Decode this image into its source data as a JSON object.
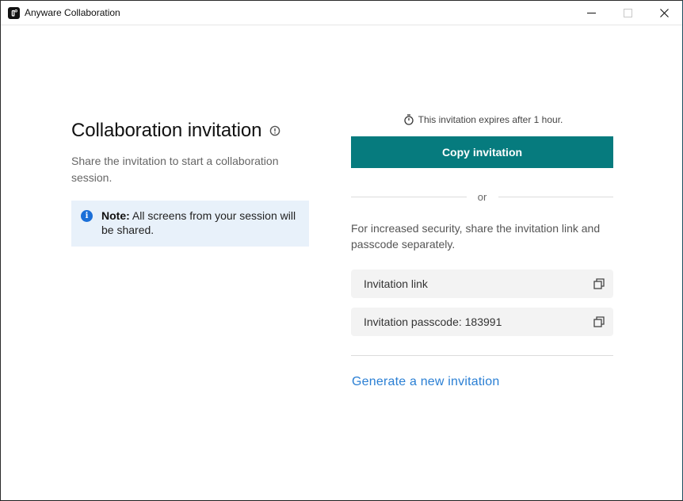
{
  "window": {
    "title": "Anyware Collaboration",
    "app_icon": "anyware-logo-icon",
    "controls": {
      "minimize": "minimize-icon",
      "maximize": "maximize-icon",
      "close": "close-icon"
    }
  },
  "left_panel": {
    "heading": "Collaboration invitation",
    "heading_icon": "info-outline-icon",
    "subtitle": "Share the invitation to start a collaboration session.",
    "note": {
      "icon": "info-filled-icon",
      "label": "Note:",
      "text": " All screens from your session will be shared."
    }
  },
  "right_panel": {
    "expiry_icon": "timer-icon",
    "expiry_text": "This invitation expires after 1 hour.",
    "copy_button": "Copy invitation",
    "or_text": "or",
    "security_text": "For increased security, share the invitation link and passcode separately.",
    "fields": [
      {
        "label": "Invitation link",
        "icon": "copy-icon"
      },
      {
        "label": "Invitation passcode: 183991",
        "icon": "copy-icon"
      }
    ],
    "generate_link": "Generate a new invitation"
  },
  "colors": {
    "primary_button": "#067b7e",
    "link": "#2a7fd4",
    "note_background": "#e8f1fa",
    "note_icon": "#1a6fd8",
    "field_background": "#f3f3f3"
  }
}
